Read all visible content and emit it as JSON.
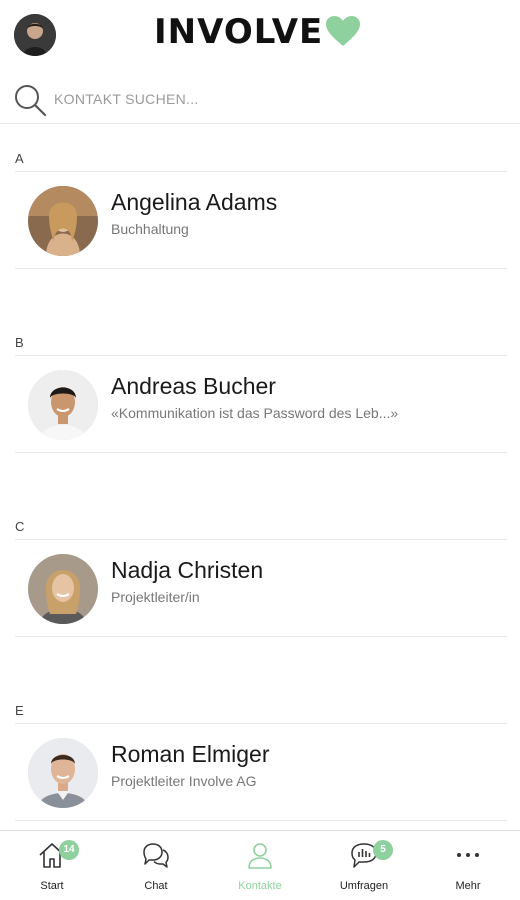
{
  "app": {
    "logo_text": "INVOLVE",
    "accent_color": "#8fd19e"
  },
  "search": {
    "placeholder": "KONTAKT SUCHEN...",
    "value": ""
  },
  "sections": [
    {
      "letter": "A",
      "contact": {
        "name": "Angelina Adams",
        "subtitle": "Buchhaltung"
      }
    },
    {
      "letter": "B",
      "contact": {
        "name": "Andreas Bucher",
        "subtitle": "«Kommunikation ist das Password des Leb...»"
      }
    },
    {
      "letter": "C",
      "contact": {
        "name": "Nadja Christen",
        "subtitle": "Projektleiter/in"
      }
    },
    {
      "letter": "E",
      "contact": {
        "name": "Roman Elmiger",
        "subtitle": "Projektleiter Involve AG"
      }
    }
  ],
  "nav": {
    "items": [
      {
        "label": "Start",
        "icon": "home-icon",
        "badge": "14"
      },
      {
        "label": "Chat",
        "icon": "chat-icon"
      },
      {
        "label": "Kontakte",
        "icon": "person-icon",
        "active": true
      },
      {
        "label": "Umfragen",
        "icon": "poll-chat-icon",
        "badge": "5"
      },
      {
        "label": "Mehr",
        "icon": "more-dots-icon"
      }
    ]
  }
}
